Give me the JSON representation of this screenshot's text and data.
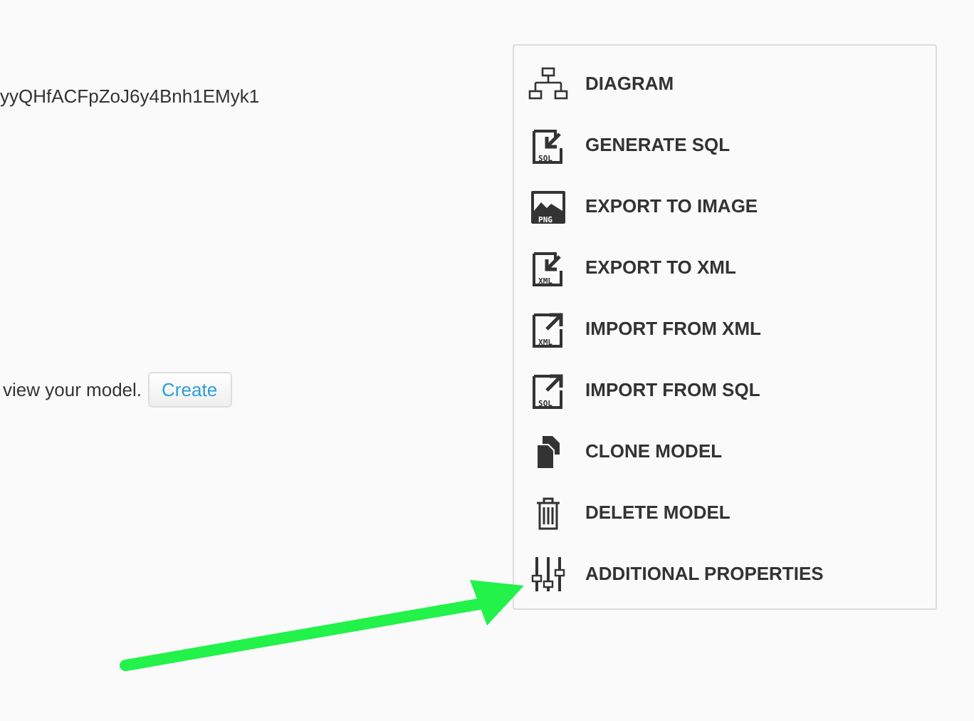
{
  "key_text": "yyQHfACFpZoJ6y4Bnh1EMyk1",
  "prompt": {
    "text": "view your model.",
    "button": "Create"
  },
  "menu": [
    {
      "kind": "diagram",
      "label": "DIAGRAM"
    },
    {
      "kind": "import-arrow",
      "badge": "SQL",
      "label": "GENERATE SQL"
    },
    {
      "kind": "image",
      "badge": "PNG",
      "label": "EXPORT TO IMAGE"
    },
    {
      "kind": "import-arrow",
      "badge": "XML",
      "label": "EXPORT TO XML"
    },
    {
      "kind": "export-arrow",
      "badge": "XML",
      "label": "IMPORT FROM XML"
    },
    {
      "kind": "export-arrow",
      "badge": "SQL",
      "label": "IMPORT FROM SQL"
    },
    {
      "kind": "clone",
      "label": "CLONE MODEL"
    },
    {
      "kind": "trash",
      "label": "DELETE MODEL"
    },
    {
      "kind": "sliders",
      "label": "ADDITIONAL PROPERTIES"
    }
  ]
}
